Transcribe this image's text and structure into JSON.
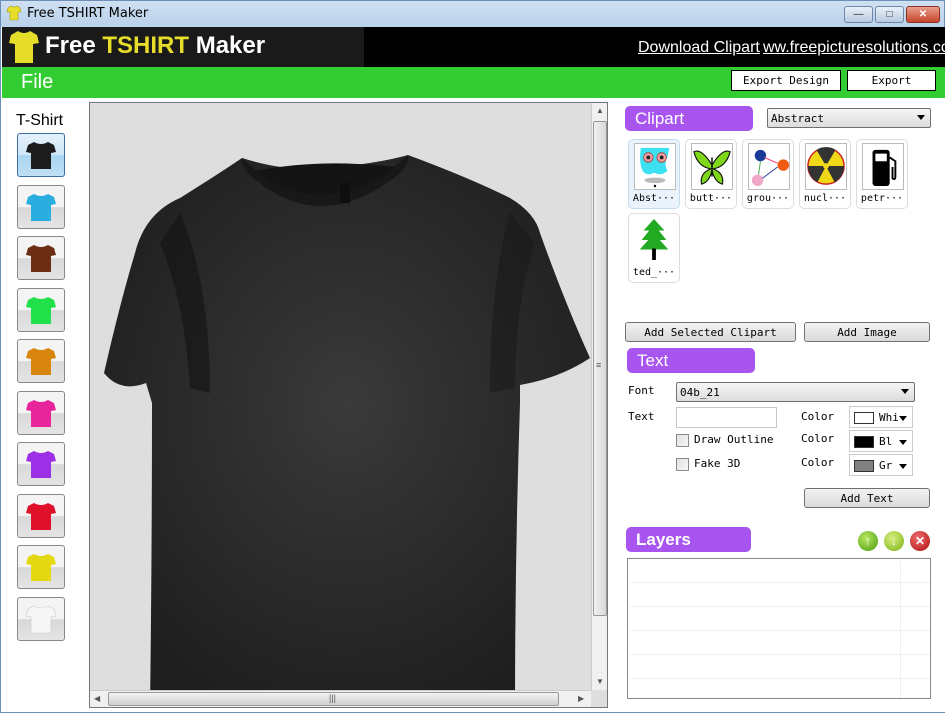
{
  "window": {
    "title": "Free TSHIRT Maker",
    "controls": {
      "minimize": "—",
      "maximize": "□",
      "close": "✕"
    }
  },
  "banner": {
    "logo_word1": "Free ",
    "logo_word2": "TSHIRT",
    "logo_word3": " Maker",
    "download_link": "Download Clipart",
    "site_link": "ww.freepicturesolutions.co",
    "logo_color": "#e6dc2a"
  },
  "menubar": {
    "file_label": "File",
    "export_design_label": "Export Design",
    "export_label": "Export",
    "bg_color": "#33cc33"
  },
  "tshirt_panel": {
    "label": "T-Shirt",
    "selected_index": 0,
    "colors": [
      {
        "name": "black",
        "hex": "#1c1c1c"
      },
      {
        "name": "cyan",
        "hex": "#2aaee0"
      },
      {
        "name": "brown",
        "hex": "#6b2e14"
      },
      {
        "name": "green",
        "hex": "#22e04a"
      },
      {
        "name": "orange",
        "hex": "#d9860e"
      },
      {
        "name": "pink",
        "hex": "#e8259a"
      },
      {
        "name": "purple",
        "hex": "#9b30e6"
      },
      {
        "name": "red",
        "hex": "#e0102a"
      },
      {
        "name": "yellow",
        "hex": "#e4d812"
      },
      {
        "name": "white",
        "hex": "#f6f6f6"
      }
    ]
  },
  "canvas": {
    "shirt_color": "#2c2c2c",
    "background": "#dedede"
  },
  "clipart": {
    "header": "Clipart",
    "category_selected": "Abstract",
    "items": [
      {
        "caption": "Abst···",
        "icon": "abstract-face-icon"
      },
      {
        "caption": "butt···",
        "icon": "butterfly-icon"
      },
      {
        "caption": "grou···",
        "icon": "group-diagram-icon"
      },
      {
        "caption": "nucl···",
        "icon": "nuclear-icon"
      },
      {
        "caption": "petr···",
        "icon": "petrol-pump-icon"
      },
      {
        "caption": "ted_···",
        "icon": "tree-icon"
      }
    ],
    "add_selected_label": "Add Selected Clipart",
    "add_image_label": "Add Image"
  },
  "text": {
    "header": "Text",
    "font_label": "Font",
    "font_value": "04b_21",
    "text_label": "Text",
    "text_value": "",
    "color_label": "Color",
    "text_color": {
      "name": "Whi",
      "hex": "#ffffff"
    },
    "draw_outline_label": "Draw Outline",
    "draw_outline_checked": false,
    "outline_color": {
      "name": "Bl",
      "hex": "#000000"
    },
    "fake3d_label": "Fake 3D",
    "fake3d_checked": false,
    "fake3d_color": {
      "name": "Gr",
      "hex": "#808080"
    },
    "add_text_label": "Add Text"
  },
  "layers": {
    "header": "Layers",
    "move_up": "↑",
    "move_down": "↓",
    "delete": "✕",
    "rows": []
  }
}
